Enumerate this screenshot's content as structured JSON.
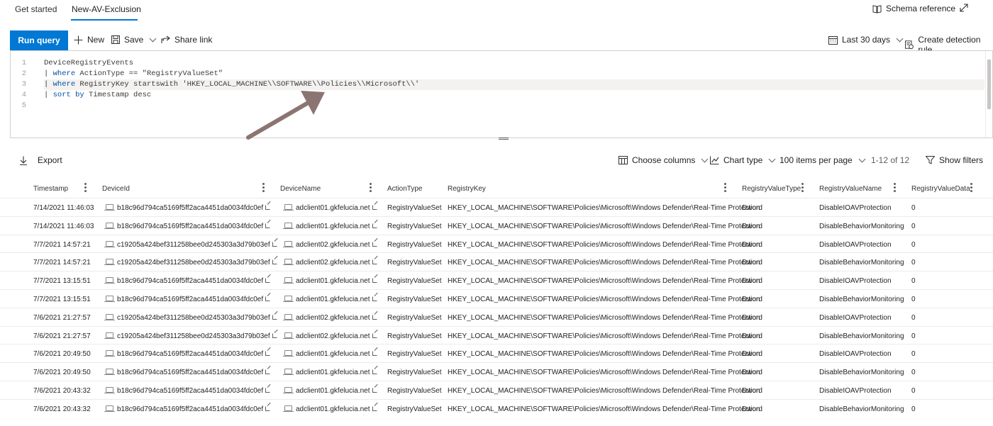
{
  "tabs": [
    {
      "label": "Get started"
    },
    {
      "label": "New-AV-Exclusion"
    }
  ],
  "header": {
    "schema_reference": "Schema reference"
  },
  "toolbar": {
    "run_query": "Run query",
    "new": "New",
    "save": "Save",
    "share_link": "Share link",
    "time_range": "Last 30 days",
    "create_detection_rule": "Create detection rule"
  },
  "editor": {
    "line_numbers": [
      "1",
      "2",
      "3",
      "4",
      "5"
    ],
    "lines": [
      {
        "a": "DeviceRegistryEvents",
        "b": "",
        "c": ""
      },
      {
        "a": "| ",
        "b": "where",
        "c": " ActionType == \"RegistryValueSet\""
      },
      {
        "a": "| ",
        "b": "where",
        "c": " RegistryKey startswith 'HKEY_LOCAL_MACHINE\\\\SOFTWARE\\\\Policies\\\\Microsoft\\\\'"
      },
      {
        "a": "| ",
        "b": "sort by",
        "c": " Timestamp desc"
      },
      {
        "a": "",
        "b": "",
        "c": ""
      }
    ]
  },
  "results": {
    "export": "Export",
    "choose_columns": "Choose columns",
    "chart_type": "Chart type",
    "items_per_page": "100 items per page",
    "range": "1-12 of 12",
    "show_filters": "Show filters"
  },
  "table": {
    "columns": [
      "Timestamp",
      "DeviceId",
      "DeviceName",
      "ActionType",
      "RegistryKey",
      "RegistryValueType",
      "RegistryValueName",
      "RegistryValueData"
    ],
    "rows": [
      [
        "7/14/2021 11:46:03",
        "b18c96d794ca5169f5ff2aca4451da0034fdc0ef",
        "adclient01.gkfelucia.net",
        "RegistryValueSet",
        "HKEY_LOCAL_MACHINE\\SOFTWARE\\Policies\\Microsoft\\Windows Defender\\Real-Time Protection",
        "Dword",
        "DisableIOAVProtection",
        "0"
      ],
      [
        "7/14/2021 11:46:03",
        "b18c96d794ca5169f5ff2aca4451da0034fdc0ef",
        "adclient01.gkfelucia.net",
        "RegistryValueSet",
        "HKEY_LOCAL_MACHINE\\SOFTWARE\\Policies\\Microsoft\\Windows Defender\\Real-Time Protection",
        "Dword",
        "DisableBehaviorMonitoring",
        "0"
      ],
      [
        "7/7/2021 14:57:21",
        "c19205a424bef311258bee0d245303a3d79b03ef",
        "adclient02.gkfelucia.net",
        "RegistryValueSet",
        "HKEY_LOCAL_MACHINE\\SOFTWARE\\Policies\\Microsoft\\Windows Defender\\Real-Time Protection",
        "Dword",
        "DisableIOAVProtection",
        "0"
      ],
      [
        "7/7/2021 14:57:21",
        "c19205a424bef311258bee0d245303a3d79b03ef",
        "adclient02.gkfelucia.net",
        "RegistryValueSet",
        "HKEY_LOCAL_MACHINE\\SOFTWARE\\Policies\\Microsoft\\Windows Defender\\Real-Time Protection",
        "Dword",
        "DisableBehaviorMonitoring",
        "0"
      ],
      [
        "7/7/2021 13:15:51",
        "b18c96d794ca5169f5ff2aca4451da0034fdc0ef",
        "adclient01.gkfelucia.net",
        "RegistryValueSet",
        "HKEY_LOCAL_MACHINE\\SOFTWARE\\Policies\\Microsoft\\Windows Defender\\Real-Time Protection",
        "Dword",
        "DisableIOAVProtection",
        "0"
      ],
      [
        "7/7/2021 13:15:51",
        "b18c96d794ca5169f5ff2aca4451da0034fdc0ef",
        "adclient01.gkfelucia.net",
        "RegistryValueSet",
        "HKEY_LOCAL_MACHINE\\SOFTWARE\\Policies\\Microsoft\\Windows Defender\\Real-Time Protection",
        "Dword",
        "DisableBehaviorMonitoring",
        "0"
      ],
      [
        "7/6/2021 21:27:57",
        "c19205a424bef311258bee0d245303a3d79b03ef",
        "adclient02.gkfelucia.net",
        "RegistryValueSet",
        "HKEY_LOCAL_MACHINE\\SOFTWARE\\Policies\\Microsoft\\Windows Defender\\Real-Time Protection",
        "Dword",
        "DisableIOAVProtection",
        "0"
      ],
      [
        "7/6/2021 21:27:57",
        "c19205a424bef311258bee0d245303a3d79b03ef",
        "adclient02.gkfelucia.net",
        "RegistryValueSet",
        "HKEY_LOCAL_MACHINE\\SOFTWARE\\Policies\\Microsoft\\Windows Defender\\Real-Time Protection",
        "Dword",
        "DisableBehaviorMonitoring",
        "0"
      ],
      [
        "7/6/2021 20:49:50",
        "b18c96d794ca5169f5ff2aca4451da0034fdc0ef",
        "adclient01.gkfelucia.net",
        "RegistryValueSet",
        "HKEY_LOCAL_MACHINE\\SOFTWARE\\Policies\\Microsoft\\Windows Defender\\Real-Time Protection",
        "Dword",
        "DisableIOAVProtection",
        "0"
      ],
      [
        "7/6/2021 20:49:50",
        "b18c96d794ca5169f5ff2aca4451da0034fdc0ef",
        "adclient01.gkfelucia.net",
        "RegistryValueSet",
        "HKEY_LOCAL_MACHINE\\SOFTWARE\\Policies\\Microsoft\\Windows Defender\\Real-Time Protection",
        "Dword",
        "DisableBehaviorMonitoring",
        "0"
      ],
      [
        "7/6/2021 20:43:32",
        "b18c96d794ca5169f5ff2aca4451da0034fdc0ef",
        "adclient01.gkfelucia.net",
        "RegistryValueSet",
        "HKEY_LOCAL_MACHINE\\SOFTWARE\\Policies\\Microsoft\\Windows Defender\\Real-Time Protection",
        "Dword",
        "DisableIOAVProtection",
        "0"
      ],
      [
        "7/6/2021 20:43:32",
        "b18c96d794ca5169f5ff2aca4451da0034fdc0ef",
        "adclient01.gkfelucia.net",
        "RegistryValueSet",
        "HKEY_LOCAL_MACHINE\\SOFTWARE\\Policies\\Microsoft\\Windows Defender\\Real-Time Protection",
        "Dword",
        "DisableBehaviorMonitoring",
        "0"
      ]
    ]
  },
  "colors": {
    "accent": "#0078d4",
    "annotation_arrow": "#8b7572"
  },
  "icons": [
    "book-icon",
    "expand-icon",
    "plus-icon",
    "save-icon",
    "share-icon",
    "calendar-icon",
    "detection-rule-icon",
    "download-icon",
    "columns-icon",
    "chart-icon",
    "filter-icon",
    "device-icon",
    "external-link-icon"
  ]
}
